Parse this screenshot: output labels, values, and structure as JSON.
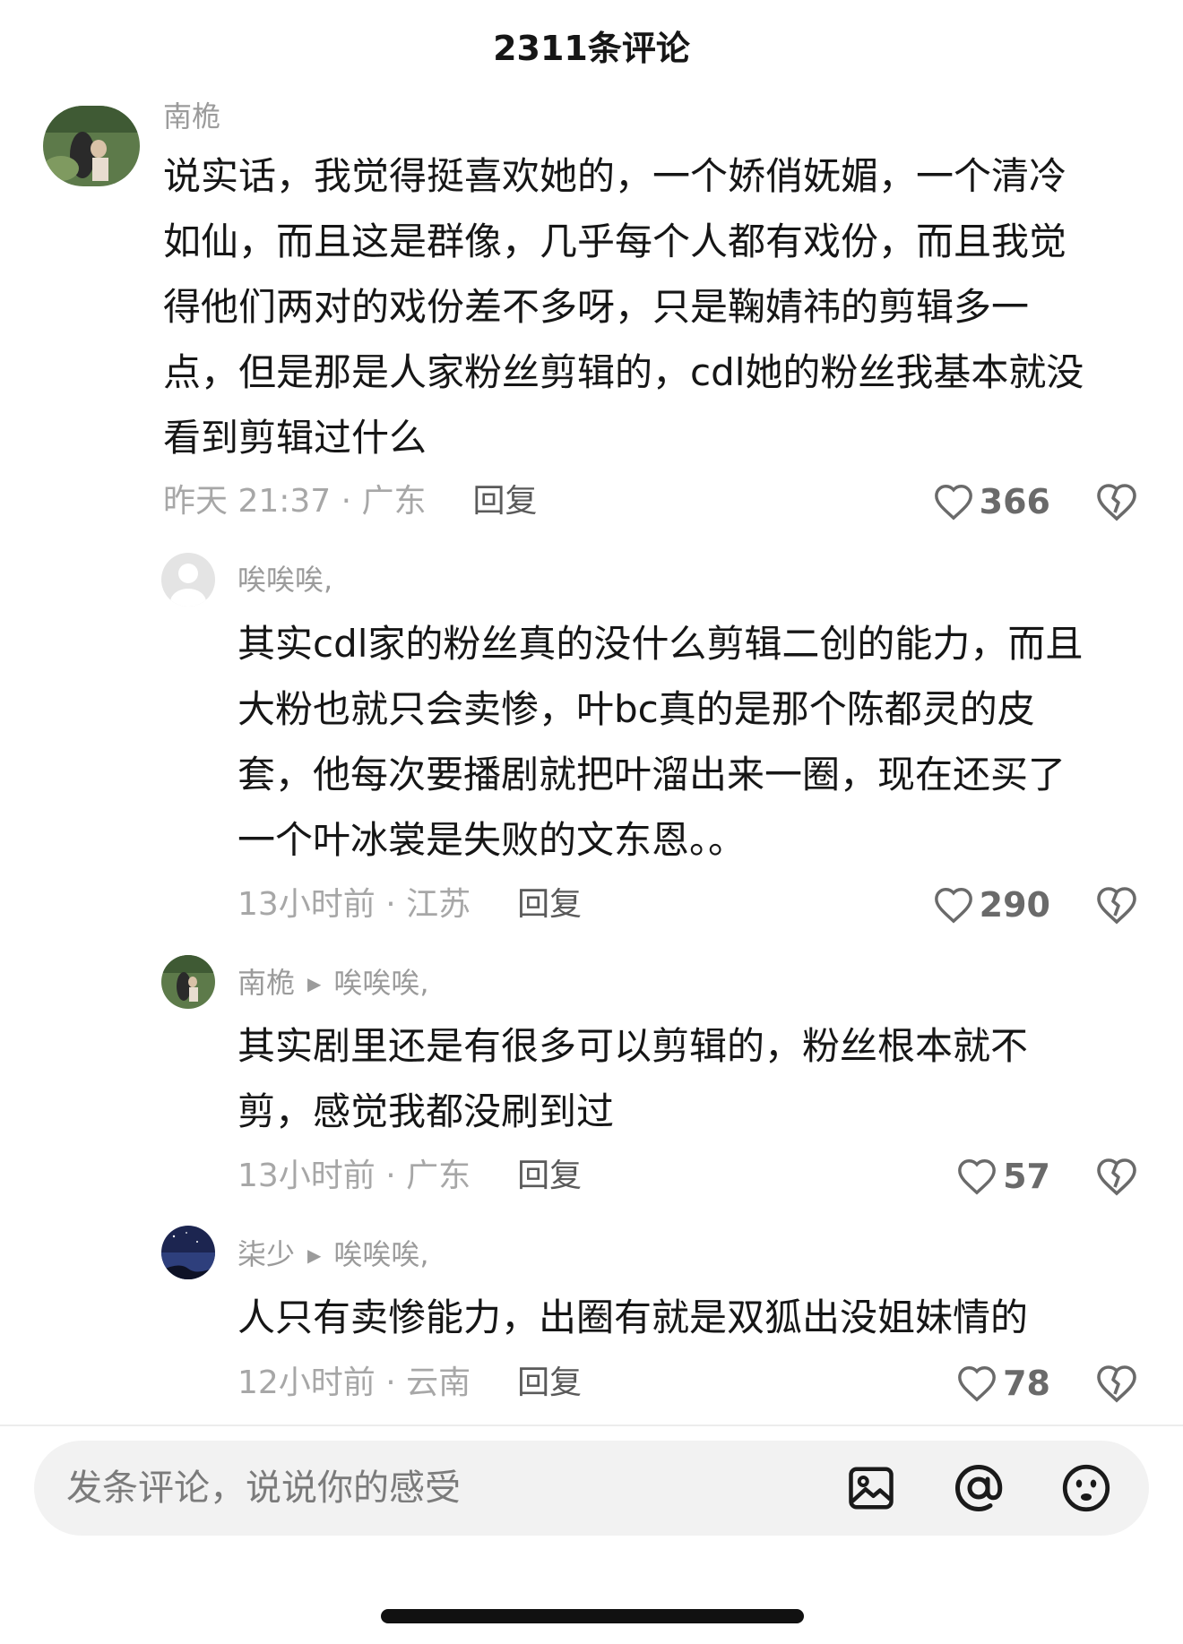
{
  "header": {
    "title": "2311条评论"
  },
  "comments": [
    {
      "author": "南桅",
      "text_lines": [
        "说实话，我觉得挺喜欢她的，一个娇俏妩媚，一个清冷",
        "如仙，而且这是群像，几乎每个人都有戏份，而且我觉",
        "得他们两对的戏份差不多呀，只是鞠婧祎的剪辑多一",
        "点，但是那是人家粉丝剪辑的，cdl她的粉丝我基本就没",
        "看到剪辑过什么"
      ],
      "time": "昨天 21:37 · 广东",
      "reply_label": "回复",
      "likes": "366"
    },
    {
      "author": "唉唉唉,",
      "text_lines": [
        "其实cdl家的粉丝真的没什么剪辑二创的能力，而且",
        "大粉也就只会卖惨，叶bc真的是那个陈都灵的皮",
        "套，他每次要播剧就把叶溜出来一圈，现在还买了",
        "一个叶冰裳是失败的文东恩。。"
      ],
      "time": "13小时前 · 江苏",
      "reply_label": "回复",
      "likes": "290"
    },
    {
      "author": "南桅",
      "reply_to": "唉唉唉,",
      "text_lines": [
        "其实剧里还是有很多可以剪辑的，粉丝根本就不",
        "剪，感觉我都没刷到过"
      ],
      "time": "13小时前 · 广东",
      "reply_label": "回复",
      "likes": "57"
    },
    {
      "author": "柒少",
      "reply_to": "唉唉唉,",
      "text_lines": [
        "人只有卖惨能力，出圈有就是双狐出没姐妹情的"
      ],
      "time": "12小时前 · 云南",
      "reply_label": "回复",
      "likes": "78"
    }
  ],
  "input_bar": {
    "placeholder": "发条评论，说说你的感受"
  },
  "icons": {
    "like": "heart-outline-icon",
    "dislike": "broken-heart-icon",
    "image": "image-icon",
    "mention": "at-sign-icon",
    "emoji": "emoji-icon",
    "reply_arrow": "triangle-right-icon"
  },
  "colors": {
    "text": "#161616",
    "meta": "#a7a7a7",
    "author": "#9b9b9b",
    "input_bg": "#f2f2f2"
  }
}
